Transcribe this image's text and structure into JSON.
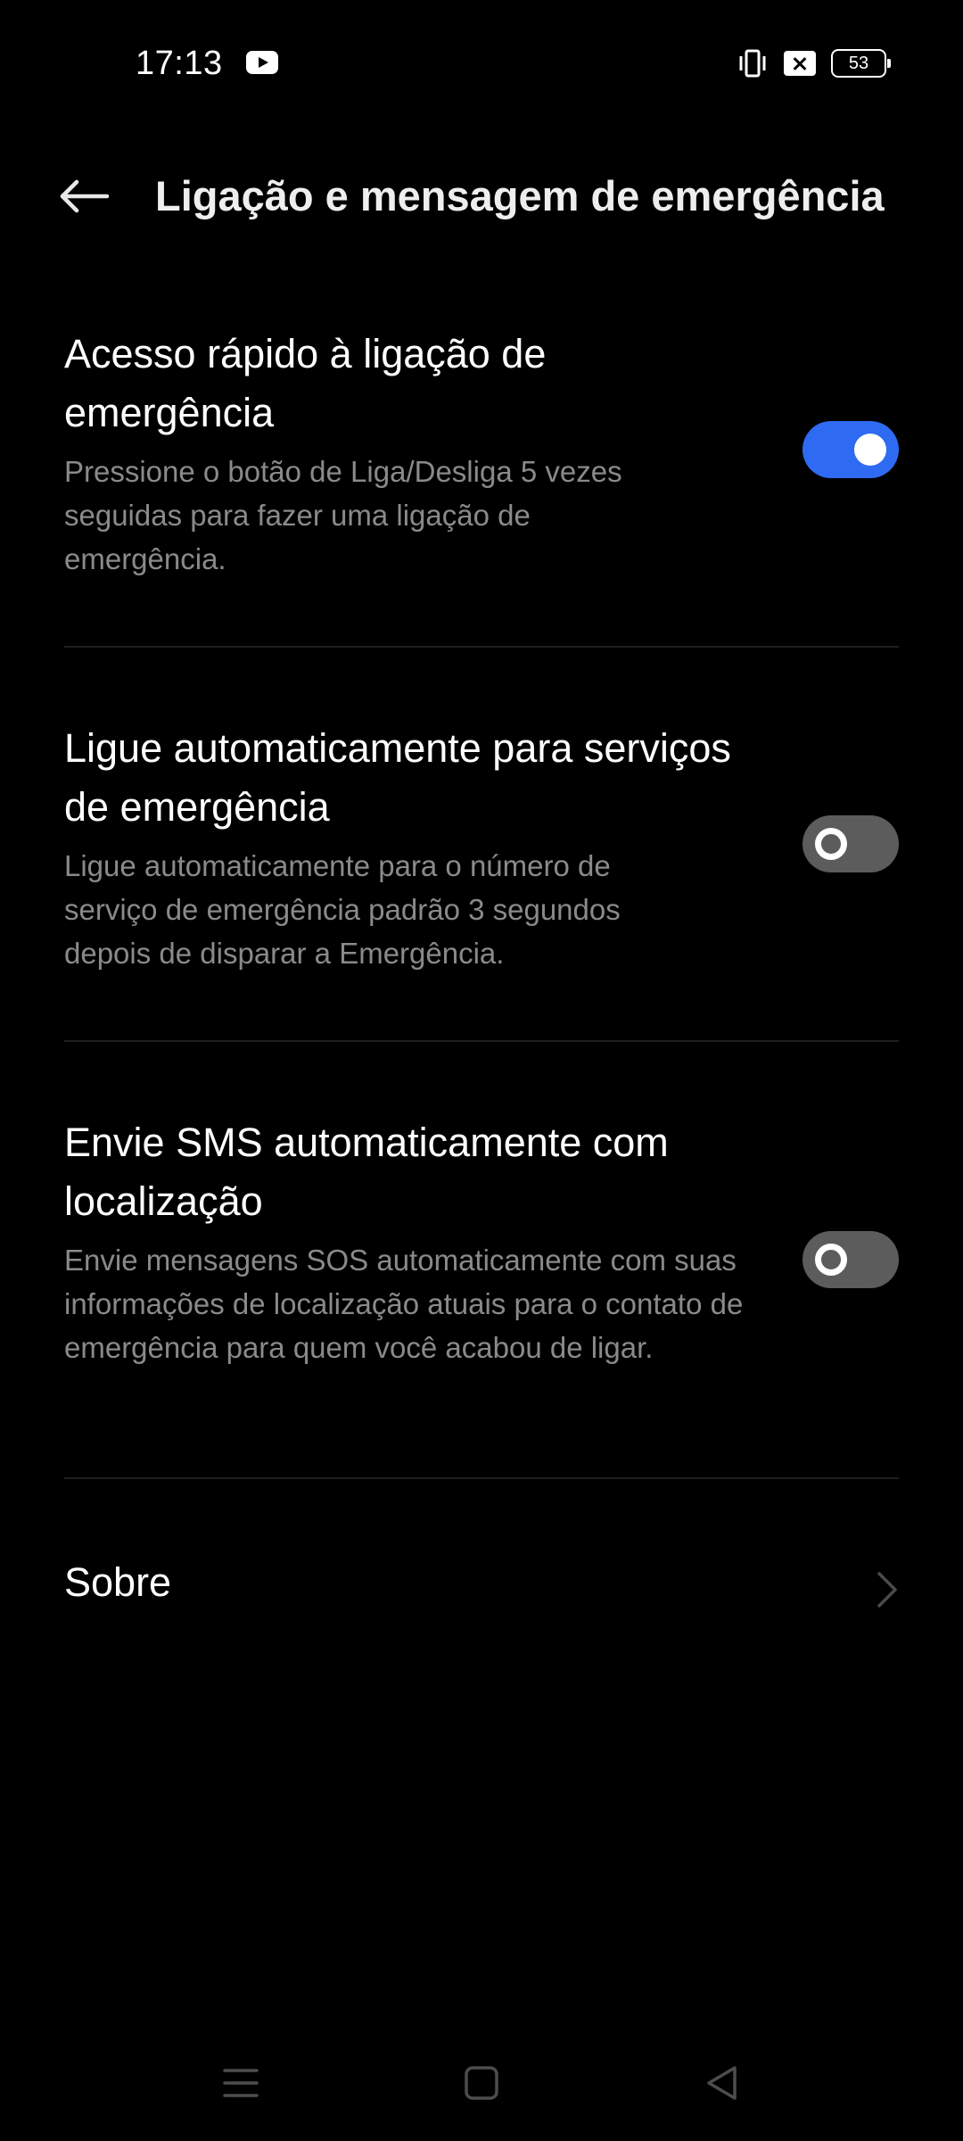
{
  "status_bar": {
    "time": "17:13",
    "battery_level": "53",
    "icons": [
      "youtube-icon",
      "vibrate-icon",
      "xbox-icon",
      "battery-icon"
    ]
  },
  "header": {
    "title": "Ligação e mensagem de emergência",
    "back_icon": "arrow-left-icon"
  },
  "settings": [
    {
      "title": "Acesso rápido à ligação de emergência",
      "description": "Pressione o botão de Liga/Desliga 5 vezes seguidas para fazer uma ligação de emergência.",
      "enabled": true
    },
    {
      "title": "Ligue automaticamente para serviços de emergência",
      "description": "Ligue automaticamente para o número de serviço de emergência padrão 3 segundos depois de disparar a Emergência.",
      "enabled": false
    },
    {
      "title": "Envie SMS automaticamente com localização",
      "description": "Envie mensagens SOS automaticamente com suas informações de localização atuais para o contato de emergência para quem você acabou de ligar.",
      "enabled": false
    }
  ],
  "about": {
    "label": "Sobre",
    "icon": "chevron-right-icon"
  },
  "nav_bar": {
    "icons": [
      "menu-icon",
      "home-icon",
      "back-triangle-icon"
    ]
  },
  "colors": {
    "background": "#000000",
    "accent": "#2f6bf2",
    "toggle_off": "#5c5c5c",
    "secondary_text": "#8a8a8a"
  }
}
